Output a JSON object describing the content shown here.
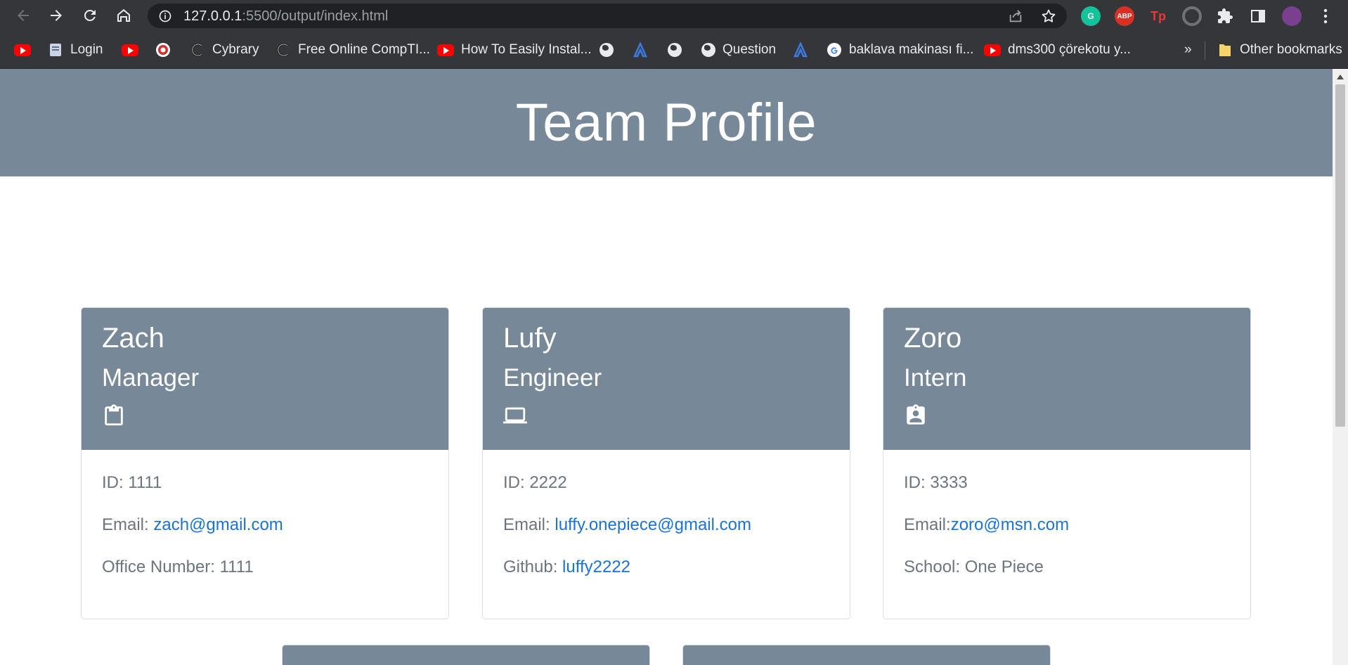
{
  "browser": {
    "url_host": "127.0.0.1",
    "url_rest": ":5500/output/index.html",
    "bookmarks": [
      {
        "label": "",
        "icon": "youtube-icon"
      },
      {
        "label": "Login",
        "icon": "document-icon"
      },
      {
        "label": "",
        "icon": "youtube-icon"
      },
      {
        "label": "",
        "icon": "target-icon"
      },
      {
        "label": "Cybrary",
        "icon": "cybrary-icon"
      },
      {
        "label": "Free Online CompTI...",
        "icon": "cybrary-icon"
      },
      {
        "label": "How To Easily Instal...",
        "icon": "youtube-icon"
      },
      {
        "label": "",
        "icon": "globe-icon"
      },
      {
        "label": "",
        "icon": "a-icon"
      },
      {
        "label": "",
        "icon": "globe-icon"
      },
      {
        "label": "Question",
        "icon": "globe-icon"
      },
      {
        "label": "",
        "icon": "a-icon"
      },
      {
        "label": "baklava makinası fi...",
        "icon": "google-icon"
      },
      {
        "label": "dms300 çörekotu y...",
        "icon": "youtube-icon"
      }
    ],
    "overflow_label": "»",
    "other_bookmarks": "Other bookmarks"
  },
  "page": {
    "title": "Team Profile",
    "cards": [
      {
        "name": "Zach",
        "role": "Manager",
        "role_icon": "clipboard-icon",
        "id_label": "ID: 1111",
        "email_prefix": "Email: ",
        "email": "zach@gmail.com",
        "extra_prefix": "Office Number: 1111",
        "extra_link": ""
      },
      {
        "name": "Lufy",
        "role": "Engineer",
        "role_icon": "laptop-icon",
        "id_label": "ID: 2222",
        "email_prefix": "Email: ",
        "email": "luffy.onepiece@gmail.com",
        "extra_prefix": "Github: ",
        "extra_link": "luffy2222"
      },
      {
        "name": "Zoro",
        "role": "Intern",
        "role_icon": "id-badge-icon",
        "id_label": "ID: 3333",
        "email_prefix": "Email:",
        "email": "zoro@msn.com",
        "extra_prefix": "School: One Piece",
        "extra_link": ""
      }
    ]
  },
  "colors": {
    "header_bg": "#778899",
    "link": "#1a73d8",
    "chrome_bg": "#35363a"
  }
}
